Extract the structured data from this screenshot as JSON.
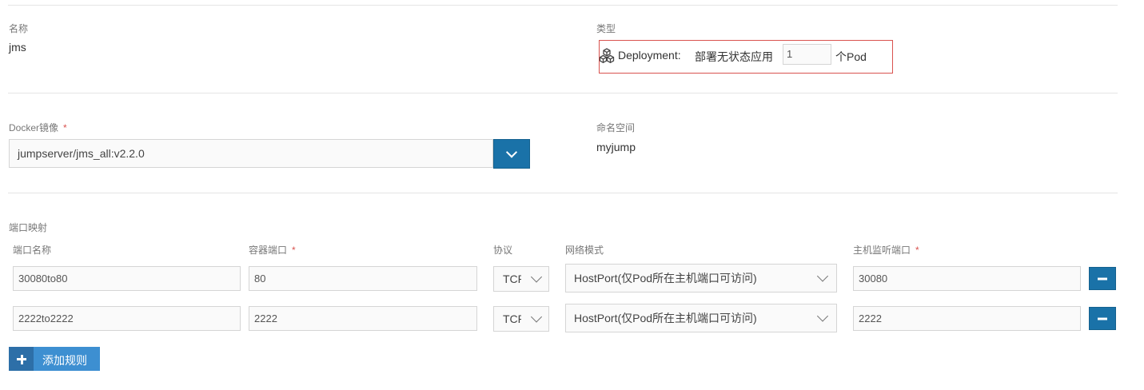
{
  "basic": {
    "name_label": "名称",
    "name_value": "jms",
    "type_label": "类型",
    "deployment_prefix": "Deployment:",
    "deployment_desc": "部署无状态应用",
    "replicas": "1",
    "replicas_suffix": "个Pod"
  },
  "image": {
    "label": "Docker镜像",
    "required": "*",
    "value": "jumpserver/jms_all:v2.2.0"
  },
  "namespace": {
    "label": "命名空间",
    "value": "myjump"
  },
  "ports": {
    "section_label": "端口映射",
    "headers": {
      "name": "端口名称",
      "container_port": "容器端口",
      "protocol": "协议",
      "network_mode": "网络模式",
      "host_port": "主机监听端口"
    },
    "required": "*",
    "rows": [
      {
        "name": "30080to80",
        "container_port": "80",
        "protocol": "TCP",
        "network_mode": "HostPort(仅Pod所在主机端口可访问)",
        "host_port": "30080"
      },
      {
        "name": "2222to2222",
        "container_port": "2222",
        "protocol": "TCP",
        "network_mode": "HostPort(仅Pod所在主机端口可访问)",
        "host_port": "2222"
      }
    ],
    "add_rule_label": "添加规则"
  },
  "colors": {
    "accent": "#1a72a8",
    "add_button": "#3d8fd1",
    "highlight_border": "#d9534f"
  },
  "icons": {
    "deployment": "cubes-icon",
    "dropdown": "chevron-down-icon",
    "remove": "minus-icon",
    "add": "plus-icon"
  }
}
